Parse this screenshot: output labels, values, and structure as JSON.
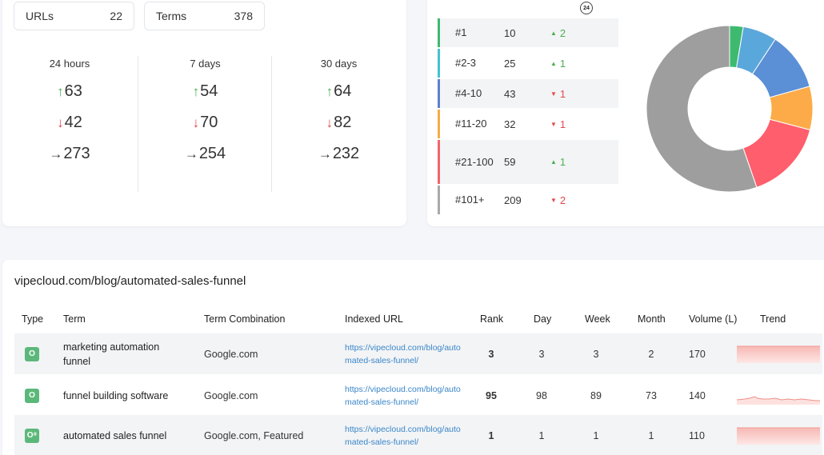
{
  "summary": {
    "urls_label": "URLs",
    "urls_value": "22",
    "terms_label": "Terms",
    "terms_value": "378"
  },
  "periods": [
    {
      "title": "24 hours",
      "up": "63",
      "down": "42",
      "flat": "273"
    },
    {
      "title": "7 days",
      "up": "54",
      "down": "70",
      "flat": "254"
    },
    {
      "title": "30 days",
      "up": "64",
      "down": "82",
      "flat": "232"
    }
  ],
  "rank_clock_label": "24",
  "ranks": [
    {
      "label": "#1",
      "count": "10",
      "dir": "up",
      "change": "2",
      "color": "#3dba6f"
    },
    {
      "label": "#2-3",
      "count": "25",
      "dir": "up",
      "change": "1",
      "color": "#45c2d1"
    },
    {
      "label": "#4-10",
      "count": "43",
      "dir": "down",
      "change": "1",
      "color": "#5f7fd0"
    },
    {
      "label": "#11-20",
      "count": "32",
      "dir": "down",
      "change": "1",
      "color": "#f7ad48"
    },
    {
      "label": "#21-100",
      "count": "59",
      "dir": "up",
      "change": "1",
      "color": "#f0656d"
    },
    {
      "label": "#101+",
      "count": "209",
      "dir": "down",
      "change": "2",
      "color": "#a9a9a9"
    }
  ],
  "chart_data": {
    "type": "pie",
    "categories": [
      "#1",
      "#2-3",
      "#4-10",
      "#11-20",
      "#21-100",
      "#101+"
    ],
    "values": [
      10,
      25,
      43,
      32,
      59,
      209
    ],
    "colors": [
      "#3dba6f",
      "#5aa7dc",
      "#5b8fd6",
      "#fdab48",
      "#ff5e6c",
      "#9e9e9e"
    ]
  },
  "table": {
    "title": "vipecloud.com/blog/automated-sales-funnel",
    "headers": {
      "type": "Type",
      "term": "Term",
      "combo": "Term Combination",
      "url": "Indexed URL",
      "rank": "Rank",
      "day": "Day",
      "week": "Week",
      "month": "Month",
      "volume": "Volume (L)",
      "trend": "Trend"
    },
    "rows": [
      {
        "type": "O",
        "term": "marketing automation funnel",
        "combo": "Google.com",
        "url": "https://vipecloud.com/blog/automated-sales-funnel/",
        "rank": "3",
        "day": "3",
        "week": "3",
        "month": "2",
        "volume": "170",
        "trend": "flat"
      },
      {
        "type": "O",
        "term": "funnel building software",
        "combo": "Google.com",
        "url": "https://vipecloud.com/blog/automated-sales-funnel/",
        "rank": "95",
        "day": "98",
        "week": "89",
        "month": "73",
        "volume": "140",
        "trend": "wavy"
      },
      {
        "type": "O⁸",
        "term": "automated sales funnel",
        "combo": "Google.com, Featured",
        "url": "https://vipecloud.com/blog/automated-sales-funnel/",
        "rank": "1",
        "day": "1",
        "week": "1",
        "month": "1",
        "volume": "110",
        "trend": "flat"
      }
    ]
  }
}
